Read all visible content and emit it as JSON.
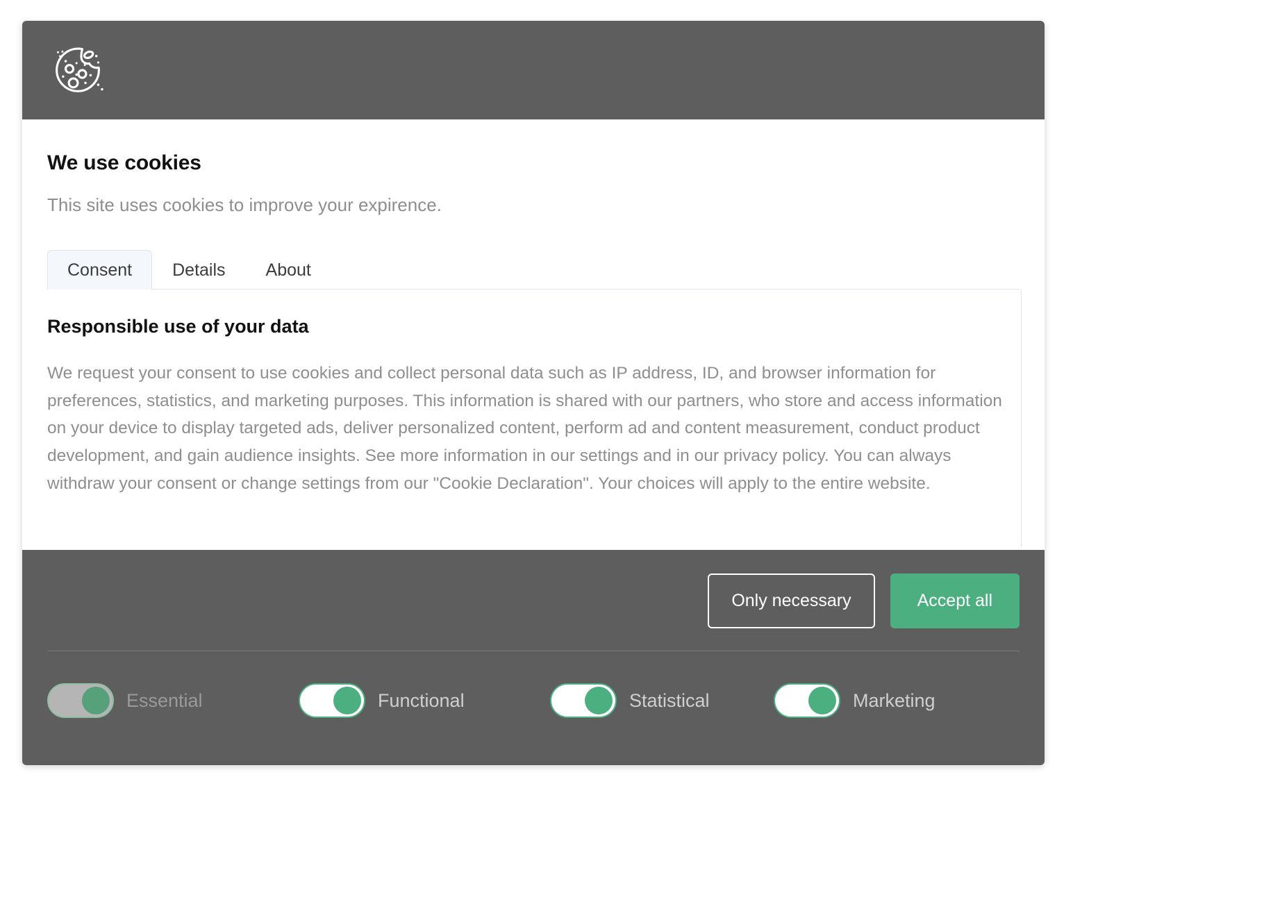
{
  "dialog": {
    "header_icon": "cookie-icon",
    "title": "We use cookies",
    "subtitle": "This site uses cookies to improve your expirence.",
    "tabs": [
      {
        "label": "Consent",
        "active": true
      },
      {
        "label": "Details",
        "active": false
      },
      {
        "label": "About",
        "active": false
      }
    ],
    "panel": {
      "heading": "Responsible use of your data",
      "body": "We request your consent to use cookies and collect personal data such as IP address, ID, and browser information for preferences, statistics, and marketing purposes. This information is shared with our partners, who store and access information on your device to display targeted ads, deliver personalized content, perform ad and content measurement, conduct product development, and gain audience insights. See more information in our settings and in our privacy policy. You can always withdraw your consent or change settings from our \"Cookie Declaration\". Your choices will apply to the entire website."
    },
    "footer": {
      "only_necessary_label": "Only necessary",
      "accept_all_label": "Accept all",
      "toggles": [
        {
          "label": "Essential",
          "on": true,
          "disabled": true
        },
        {
          "label": "Functional",
          "on": true,
          "disabled": false
        },
        {
          "label": "Statistical",
          "on": true,
          "disabled": false
        },
        {
          "label": "Marketing",
          "on": true,
          "disabled": false
        }
      ]
    }
  },
  "colors": {
    "header_bg": "#5e5e5e",
    "footer_bg": "#5e5e5e",
    "accent_green": "#4caf80",
    "active_tab_bg": "#f4f7fb",
    "body_text": "#8e8e8e"
  }
}
